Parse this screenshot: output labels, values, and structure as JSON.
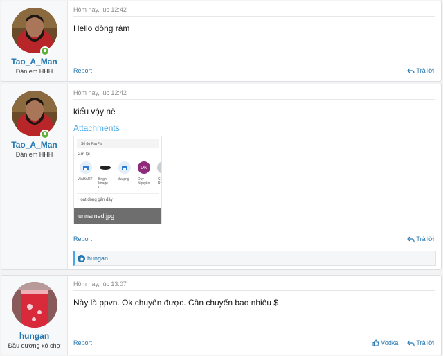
{
  "posts": [
    {
      "author": "Tao_A_Man",
      "user_title": "Đàn em HHH",
      "date": "Hôm nay, lúc 12:42",
      "body": "Hello đồng râm",
      "report": "Report",
      "reply": "Trả lời",
      "avatar_icon": "user-avatar-bearded-man"
    },
    {
      "author": "Tao_A_Man",
      "user_title": "Đàn em HHH",
      "date": "Hôm nay, lúc 12:42",
      "body": "kiểu vậy nè",
      "attachments_label": "Attachments",
      "attachment": {
        "filename": "unnamed.jpg",
        "preview": {
          "paypal_line": "Số dư PayPal",
          "section1": "Gửi lại",
          "contacts": [
            "VIAHART",
            "Bright Image C...",
            "duupng",
            "Duy Nguyễn",
            "C R"
          ],
          "avatar_initials": "DN",
          "section2": "Hoạt động gần đây"
        }
      },
      "report": "Report",
      "reply": "Trả lời",
      "reaction_user": "hungan",
      "avatar_icon": "user-avatar-bearded-man"
    },
    {
      "author": "hungan",
      "user_title": "Đầu đường xó chợ",
      "date": "Hôm nay, lúc 13:07",
      "body": "Này là ppvn. Ok chuyển được. Cần chuyển bao nhiêu $",
      "report": "Report",
      "like": "Vodka",
      "reply": "Trả lời",
      "avatar_icon": "user-avatar-red-drink"
    }
  ],
  "colors": {
    "link": "#2577b1",
    "accent": "#47a7eb",
    "online": "#63b240"
  }
}
